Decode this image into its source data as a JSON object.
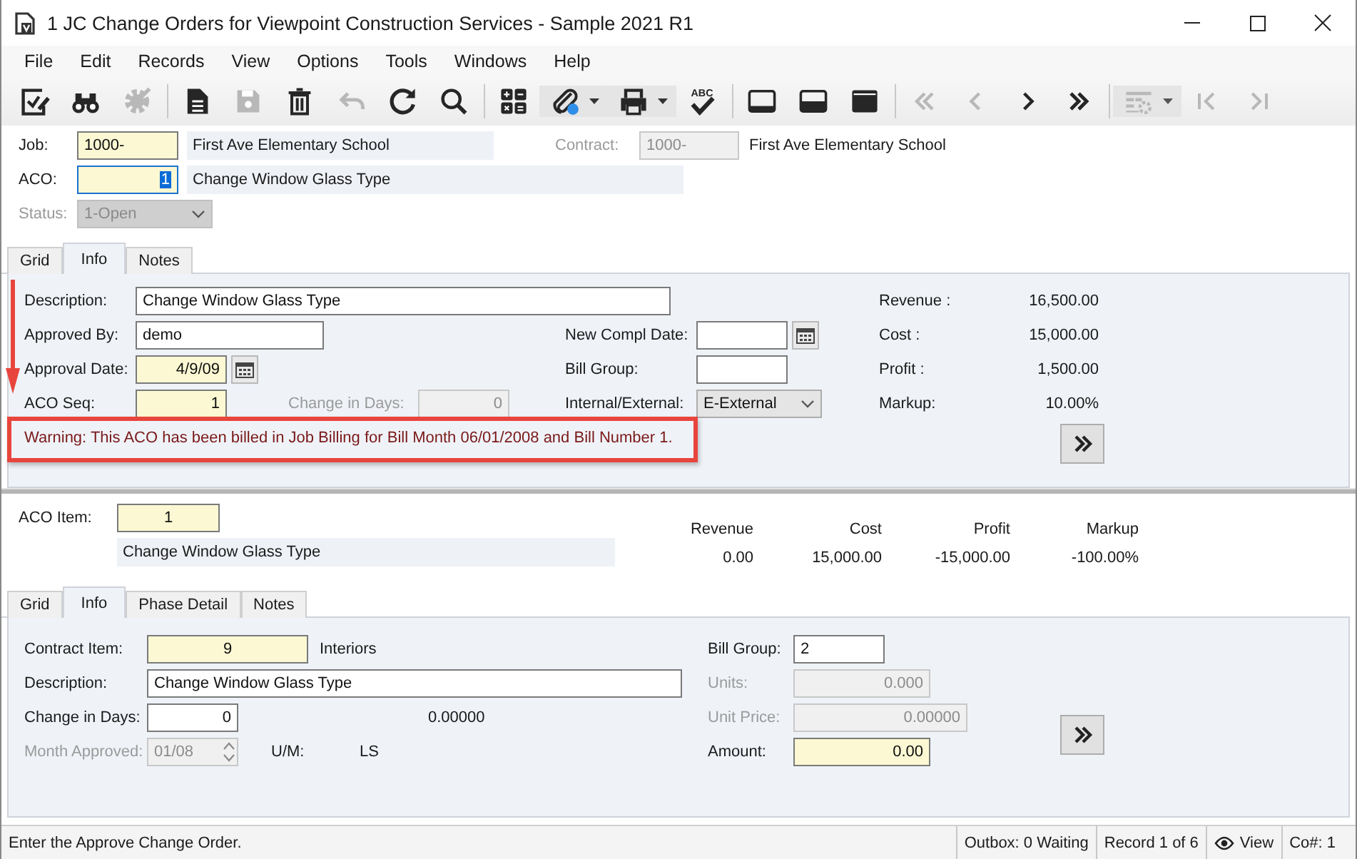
{
  "window": {
    "title": "1 JC Change Orders for Viewpoint Construction Services - Sample 2021 R1"
  },
  "menu": [
    "File",
    "Edit",
    "Records",
    "View",
    "Options",
    "Tools",
    "Windows",
    "Help"
  ],
  "toolbar": [
    {
      "kind": "edit",
      "disabled": false
    },
    {
      "kind": "find",
      "disabled": false
    },
    {
      "kind": "settings",
      "disabled": true
    },
    {
      "kind": "separator"
    },
    {
      "kind": "new",
      "disabled": false
    },
    {
      "kind": "save",
      "disabled": true
    },
    {
      "kind": "delete",
      "disabled": false
    },
    {
      "kind": "undo",
      "disabled": true
    },
    {
      "kind": "refresh",
      "disabled": false
    },
    {
      "kind": "search",
      "disabled": false
    },
    {
      "kind": "separator"
    },
    {
      "kind": "calculator",
      "disabled": false
    },
    {
      "kind": "attach",
      "disabled": false,
      "dropdown": true
    },
    {
      "kind": "print",
      "disabled": false,
      "dropdown": true
    },
    {
      "kind": "spellcheck",
      "disabled": false,
      "label": "ABC"
    },
    {
      "kind": "separator"
    },
    {
      "kind": "layout_bottom",
      "disabled": false
    },
    {
      "kind": "layout_middle",
      "disabled": false
    },
    {
      "kind": "layout_full",
      "disabled": false
    },
    {
      "kind": "separator"
    },
    {
      "kind": "first",
      "disabled": true
    },
    {
      "kind": "prev",
      "disabled": true
    },
    {
      "kind": "next",
      "disabled": false
    },
    {
      "kind": "last",
      "disabled": false
    },
    {
      "kind": "separator"
    },
    {
      "kind": "grid_settings",
      "disabled": true,
      "dropdown": true
    },
    {
      "kind": "first_record",
      "disabled": true
    },
    {
      "kind": "last_record",
      "disabled": true
    }
  ],
  "header": {
    "job": {
      "label": "Job:",
      "value": "1000-",
      "required": true,
      "disabled": false,
      "description": "First Ave Elementary School"
    },
    "contract": {
      "label": "Contract:",
      "value": "1000-",
      "disabled": true,
      "description": "First Ave Elementary School"
    },
    "aco": {
      "label": "ACO:",
      "value": "1",
      "required": true,
      "disabled": false,
      "value_selected": true,
      "description": "Change Window Glass Type"
    },
    "status": {
      "label": "Status:",
      "value": "1-Open",
      "disabled": true
    }
  },
  "header_tabs": [
    {
      "label": "Grid",
      "selected": false
    },
    {
      "label": "Info",
      "selected": true
    },
    {
      "label": "Notes",
      "selected": false
    }
  ],
  "aco_info": {
    "description": {
      "label": "Description:",
      "value": "Change Window Glass Type",
      "required": false,
      "disabled": false
    },
    "approved_by": {
      "label": "Approved By:",
      "value": "demo",
      "required": false,
      "disabled": false
    },
    "approval_date": {
      "label": "Approval Date:",
      "value": "4/9/09",
      "required": true,
      "disabled": false
    },
    "aco_seq": {
      "label": "ACO Seq:",
      "value": "1",
      "required": true,
      "disabled": false
    },
    "change_in_days": {
      "label": "Change in Days:",
      "value": "0",
      "disabled": true
    },
    "new_compl_date": {
      "label": "New Compl Date:",
      "required": false,
      "disabled": false
    },
    "bill_group": {
      "label": "Bill Group:",
      "required": false,
      "disabled": false
    },
    "internal_external": {
      "label": "Internal/External:",
      "value": "E-External",
      "disabled": false
    },
    "totals": [
      {
        "label": "Revenue :",
        "value": "16,500.00"
      },
      {
        "label": "Cost :",
        "value": "15,000.00"
      },
      {
        "label": "Profit :",
        "value": "1,500.00"
      },
      {
        "label": "Markup:",
        "value": "10.00%"
      }
    ],
    "warning": "Warning: This ACO has been billed in Job Billing for Bill Month 06/01/2008 and Bill Number 1."
  },
  "item": {
    "aco_item": {
      "label": "ACO Item:",
      "value": "1",
      "required": true,
      "disabled": false
    },
    "description": "Change Window Glass Type",
    "summary": [
      {
        "label": "Revenue",
        "value": "0.00"
      },
      {
        "label": "Cost",
        "value": "15,000.00"
      },
      {
        "label": "Profit",
        "value": "-15,000.00"
      },
      {
        "label": "Markup",
        "value": "-100.00%"
      }
    ]
  },
  "item_tabs": [
    {
      "label": "Grid",
      "selected": false
    },
    {
      "label": "Info",
      "selected": true
    },
    {
      "label": "Phase Detail",
      "selected": false
    },
    {
      "label": "Notes",
      "selected": false
    }
  ],
  "item_info": {
    "contract_item": {
      "label": "Contract Item:",
      "value": "9",
      "required": true,
      "disabled": false,
      "item_name": "Interiors"
    },
    "description": {
      "label": "Description:",
      "value": "Change Window Glass Type",
      "required": false,
      "disabled": false
    },
    "change_in_days": {
      "label": "Change in Days:",
      "value": "0",
      "required": false,
      "disabled": false,
      "factor": "0.00000"
    },
    "month_approved": {
      "label": "Month Approved:",
      "value": "01/08",
      "disabled": true
    },
    "um": {
      "label": "U/M:",
      "value": "LS"
    },
    "bill_group": {
      "label": "Bill Group:",
      "value": "2",
      "required": false,
      "disabled": false
    },
    "units": {
      "label": "Units:",
      "value": "0.000",
      "disabled": true
    },
    "unit_price": {
      "label": "Unit Price:",
      "value": "0.00000",
      "disabled": true
    },
    "amount": {
      "label": "Amount:",
      "value": "0.00",
      "required": true,
      "disabled": false
    }
  },
  "status_bar": {
    "message": "Enter the Approve Change Order.",
    "outbox": "Outbox: 0 Waiting",
    "record": "Record 1 of 6",
    "mode": "View",
    "company": "Co#: 1"
  }
}
